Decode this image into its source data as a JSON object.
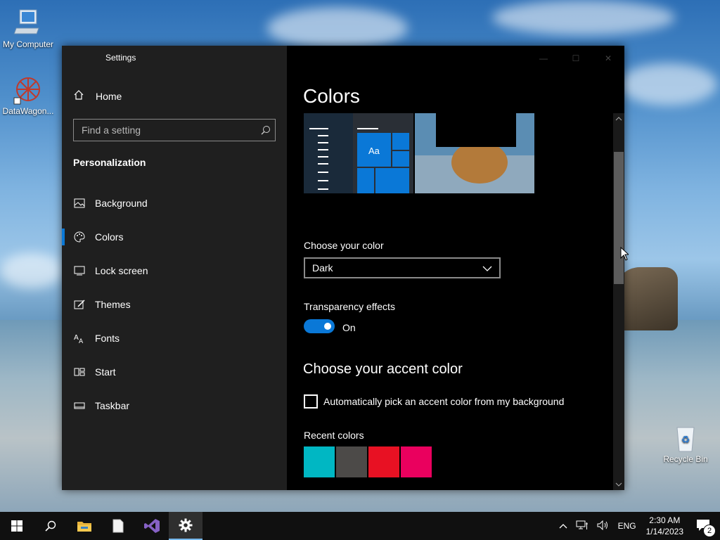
{
  "desktop": {
    "icons": [
      {
        "label": "My Computer"
      },
      {
        "label": "DataWagon..."
      },
      {
        "label": "Recycle Bin"
      }
    ]
  },
  "window": {
    "title": "Settings",
    "sidebar": {
      "home": "Home",
      "search_placeholder": "Find a setting",
      "section": "Personalization",
      "items": [
        {
          "label": "Background",
          "icon": "image-icon"
        },
        {
          "label": "Colors",
          "icon": "palette-icon",
          "active": true
        },
        {
          "label": "Lock screen",
          "icon": "lock-screen-icon"
        },
        {
          "label": "Themes",
          "icon": "themes-icon"
        },
        {
          "label": "Fonts",
          "icon": "fonts-icon"
        },
        {
          "label": "Start",
          "icon": "start-icon"
        },
        {
          "label": "Taskbar",
          "icon": "taskbar-icon"
        }
      ]
    },
    "main": {
      "heading": "Colors",
      "preview": {
        "tile_text": "Aa"
      },
      "choose_color_label": "Choose your color",
      "choose_color_value": "Dark",
      "transparency_label": "Transparency effects",
      "transparency_state": "On",
      "accent_heading": "Choose your accent color",
      "auto_pick_label": "Automatically pick an accent color from my background",
      "recent_colors_label": "Recent colors",
      "recent_colors": [
        "#00b7c3",
        "#4c4a48",
        "#e81123",
        "#ea005e"
      ]
    }
  },
  "taskbar": {
    "language": "ENG",
    "time": "2:30 AM",
    "date": "1/14/2023",
    "notification_count": "2"
  },
  "colors": {
    "accent": "#0a78d7"
  }
}
